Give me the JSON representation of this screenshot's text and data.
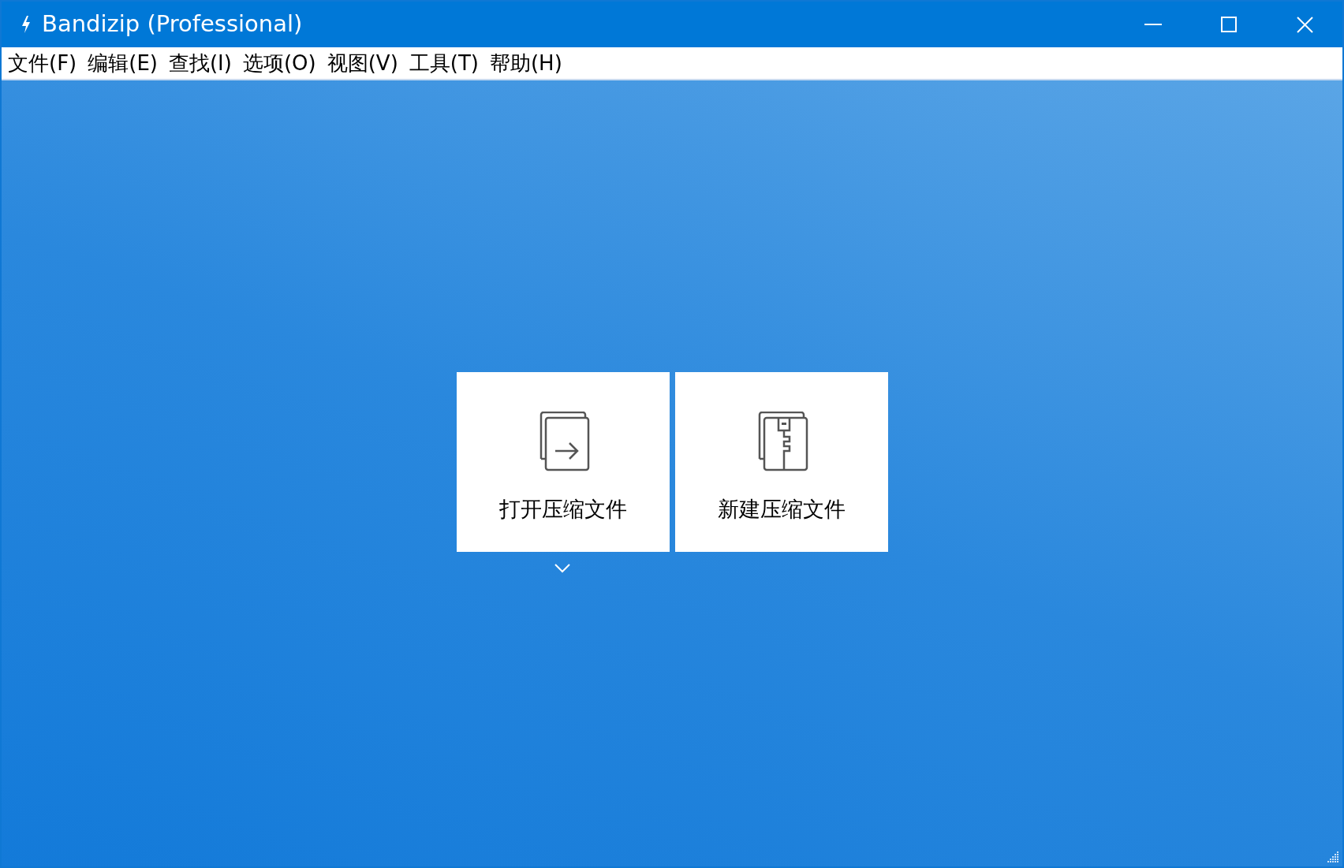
{
  "window": {
    "title": "Bandizip (Professional)"
  },
  "menu": [
    "文件(F)",
    "编辑(E)",
    "查找(I)",
    "选项(O)",
    "视图(V)",
    "工具(T)",
    "帮助(H)"
  ],
  "actions": [
    {
      "kind": "open",
      "label": "打开压缩文件"
    },
    {
      "kind": "new",
      "label": "新建压缩文件"
    }
  ]
}
